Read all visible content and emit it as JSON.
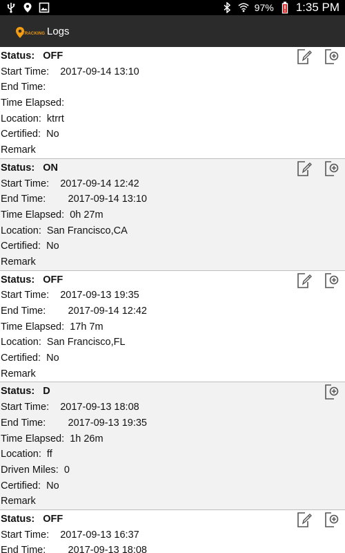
{
  "status_bar": {
    "battery": "97%",
    "time": "1:35 PM"
  },
  "app_bar": {
    "logo_text": "TRACKING",
    "title": "Logs"
  },
  "labels": {
    "status": "Status:",
    "start": "Start Time:",
    "end": "End Time:",
    "elapsed": "Time Elapsed:",
    "location": "Location:",
    "driven": "Driven Miles:",
    "certified": "Certified:",
    "remark": "Remark"
  },
  "entries": [
    {
      "status": "OFF",
      "start": "2017-09-14 13:10",
      "end": "",
      "elapsed": "",
      "location": "ktrrt",
      "certified": "No",
      "editable": true
    },
    {
      "status": "ON",
      "start": "2017-09-14 12:42",
      "end": "2017-09-14 13:10",
      "elapsed": "0h 27m",
      "location": "San Francisco,CA",
      "certified": "No",
      "editable": true
    },
    {
      "status": "OFF",
      "start": "2017-09-13 19:35",
      "end": "2017-09-14 12:42",
      "elapsed": "17h 7m",
      "location": "San Francisco,FL",
      "certified": "No",
      "editable": true
    },
    {
      "status": "D",
      "start": "2017-09-13 18:08",
      "end": "2017-09-13 19:35",
      "elapsed": "1h 26m",
      "location": "ff",
      "driven": "0",
      "certified": "No",
      "editable": false
    },
    {
      "status": "OFF",
      "start": "2017-09-13 16:37",
      "end": "2017-09-13 18:08",
      "editable": true
    }
  ],
  "colors": {
    "app_bar": "#2b2b2b",
    "status_bar": "#000000",
    "alt_row": "#f2f2f2",
    "logo_accent": "#f39c12",
    "battery_alert": "#d32f2f"
  },
  "icons": {
    "edit": "edit-document-icon",
    "add": "add-document-icon"
  }
}
